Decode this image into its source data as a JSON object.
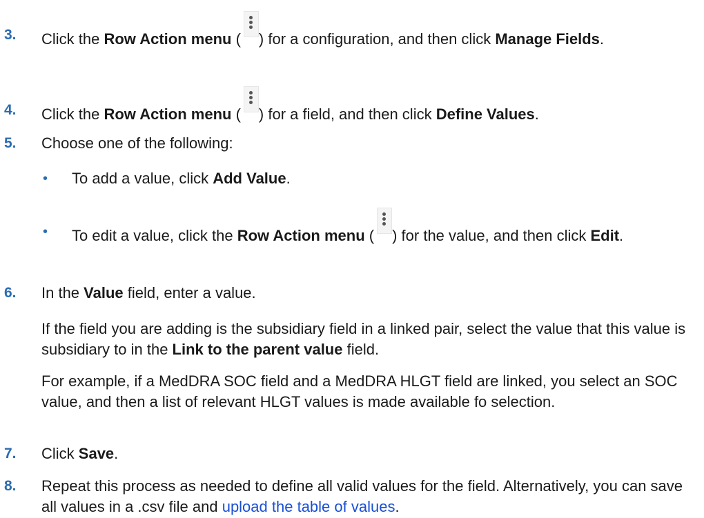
{
  "steps": [
    {
      "num": "3.",
      "parts": [
        "Click the ",
        "Row Action menu",
        " (",
        ") for a configuration, and then click ",
        "Manage Fields",
        "."
      ]
    },
    {
      "num": "4.",
      "parts": [
        "Click the ",
        "Row Action menu",
        " (",
        ") for a field, and then click ",
        "Define Values",
        "."
      ]
    },
    {
      "num": "5.",
      "text": "Choose one of the following:",
      "bullets": [
        {
          "dot": "•",
          "parts": [
            "To add a value, click ",
            "Add Value",
            "."
          ]
        },
        {
          "dot": "•",
          "parts": [
            "To edit a value, click the ",
            "Row Action menu",
            " (",
            ") for the value, and then click ",
            "Edit",
            "."
          ]
        }
      ]
    },
    {
      "num": "6.",
      "parts": [
        "In the ",
        "Value",
        " field, enter a value."
      ],
      "para1": [
        "If the field you are adding is the subsidiary field in a linked pair, select the value that this value is subsidiary to in the ",
        "Link to the parent value",
        " field."
      ],
      "para2": "For example, if a MedDRA SOC field and a MedDRA HLGT field are linked, you select an SOC value, and then a list of relevant HLGT values is made available fo selection."
    },
    {
      "num": "7.",
      "parts": [
        "Click ",
        "Save",
        "."
      ]
    },
    {
      "num": "8.",
      "parts": [
        "Repeat this process as needed to define all valid values for the field. Alternatively, you can save all values in a .csv file and ",
        "upload the table of values",
        "."
      ]
    }
  ],
  "icons": {
    "row_action": "kebab-vertical-icon"
  },
  "colors": {
    "step_number": "#2b6cb0",
    "link": "#1a4fd6",
    "text": "#1a1a1a"
  }
}
